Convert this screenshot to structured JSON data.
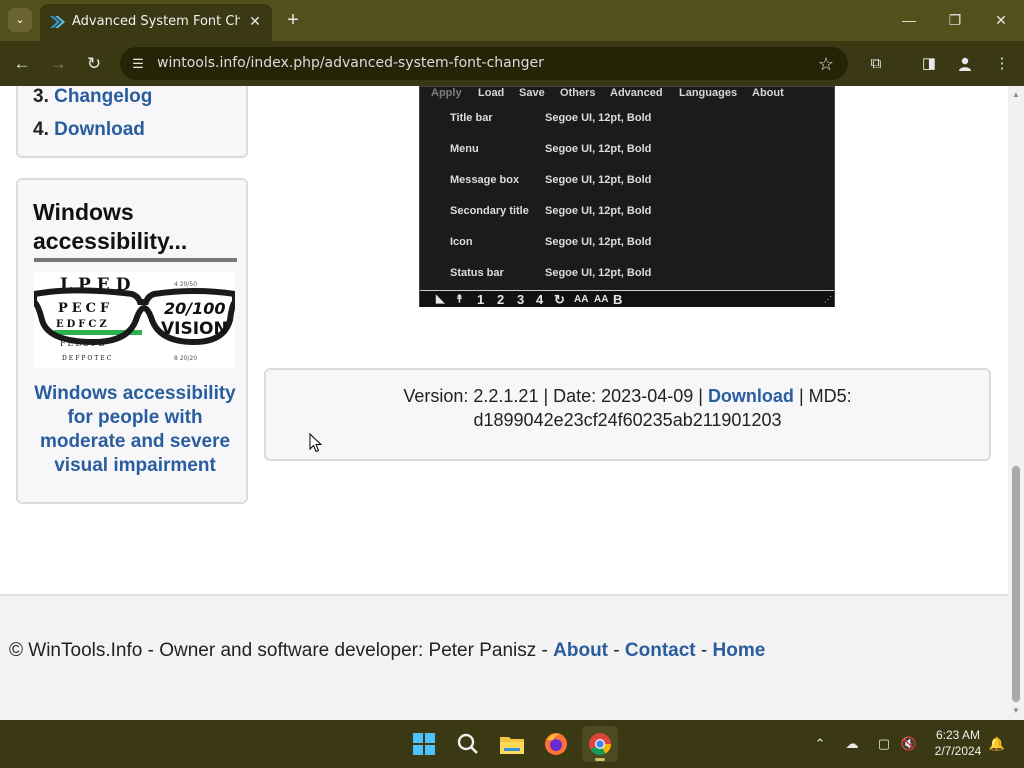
{
  "browser": {
    "tab_title": "Advanced System Font Changer",
    "url": "wintools.info/index.php/advanced-system-font-changer",
    "icons": {
      "tab_search": "chevron-down-icon",
      "tab_close": "close-icon",
      "new_tab": "plus-icon",
      "back": "arrow-left-icon",
      "forward": "arrow-right-icon",
      "reload": "reload-icon",
      "site_info": "tune-icon",
      "bookmark": "star-icon",
      "extensions": "puzzle-icon",
      "side_panel": "side-panel-icon",
      "profile": "profile-icon",
      "menu": "kebab-menu-icon"
    },
    "accent": "#54501c"
  },
  "sidebar": {
    "toc": [
      {
        "num": "3.",
        "label": "Changelog"
      },
      {
        "num": "4.",
        "label": "Download"
      }
    ],
    "accessibility": {
      "title": "Windows accessibility...",
      "image_text": {
        "chart": [
          "LPED",
          "PECF",
          "EDFCZ",
          "FELOPD",
          "DEFPOTEC"
        ],
        "vision": [
          "20/100",
          "VISION"
        ]
      },
      "link": "Windows accessibility for people with moderate and severe visual impairment"
    }
  },
  "app_screenshot": {
    "menu": [
      {
        "label": "Apply",
        "disabled": true
      },
      {
        "label": "Load",
        "disabled": false
      },
      {
        "label": "Save",
        "disabled": false
      },
      {
        "label": "Others",
        "disabled": false
      },
      {
        "label": "Advanced",
        "disabled": false
      },
      {
        "label": "Languages",
        "disabled": false
      },
      {
        "label": "About",
        "disabled": false
      }
    ],
    "rows": [
      {
        "label": "Title bar",
        "value": "Segoe UI, 12pt, Bold"
      },
      {
        "label": "Menu",
        "value": "Segoe UI, 12pt, Bold"
      },
      {
        "label": "Message box",
        "value": "Segoe UI, 12pt, Bold"
      },
      {
        "label": "Secondary title",
        "value": "Segoe UI, 12pt, Bold"
      },
      {
        "label": "Icon",
        "value": "Segoe UI, 12pt, Bold"
      },
      {
        "label": "Status bar",
        "value": "Segoe UI, 12pt, Bold"
      }
    ],
    "bottom_bar": [
      "1",
      "2",
      "3",
      "4",
      "AA",
      "AA",
      "B"
    ]
  },
  "version_info": {
    "prefix": "Version: 2.2.1.21 | Date: 2023-04-09 |",
    "download": "Download",
    "md5_label": "| MD5:",
    "md5": "d1899042e23cf24f60235ab211901203"
  },
  "footer": {
    "text": "© WinTools.Info - Owner and software developer: Peter Panisz -",
    "links": [
      "About",
      "Contact",
      "Home"
    ],
    "sep": "-"
  },
  "taskbar": {
    "apps": [
      "start-icon",
      "search-icon",
      "file-explorer-icon",
      "firefox-icon",
      "chrome-icon"
    ],
    "tray": [
      "chevron-up-icon",
      "onedrive-icon",
      "display-icon",
      "volume-muted-icon",
      "notification-bell-icon"
    ],
    "time": "6:23 AM",
    "date": "2/7/2024"
  }
}
